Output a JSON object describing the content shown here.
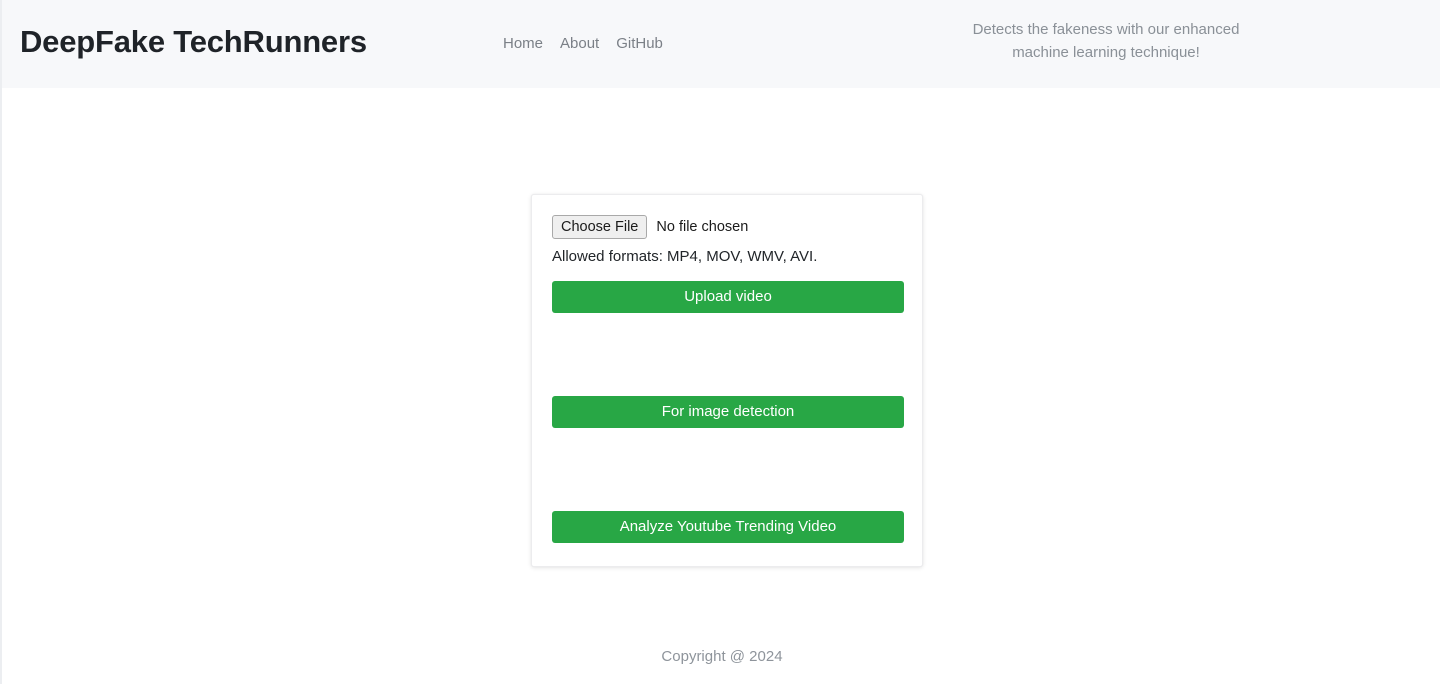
{
  "header": {
    "brand": "DeepFake TechRunners",
    "nav": [
      {
        "label": "Home",
        "name": "nav-link-home"
      },
      {
        "label": "About",
        "name": "nav-link-about"
      },
      {
        "label": "GitHub",
        "name": "nav-link-github"
      }
    ],
    "tagline": "Detects the fakeness with our enhanced machine learning technique!",
    "background_color": "#f7f8fa"
  },
  "card": {
    "file_input": {
      "button_label": "Choose File",
      "status_text": "No file chosen"
    },
    "allowed_formats": "Allowed formats: MP4, MOV, WMV, AVI.",
    "buttons": [
      {
        "label": "Upload video",
        "name": "upload-video-button"
      },
      {
        "label": "For image detection",
        "name": "image-detection-button"
      },
      {
        "label": "Analyze Youtube Trending Video",
        "name": "analyze-youtube-button"
      }
    ],
    "accent_color": "#28a745"
  },
  "footer": {
    "copyright": "Copyright @ 2024"
  }
}
